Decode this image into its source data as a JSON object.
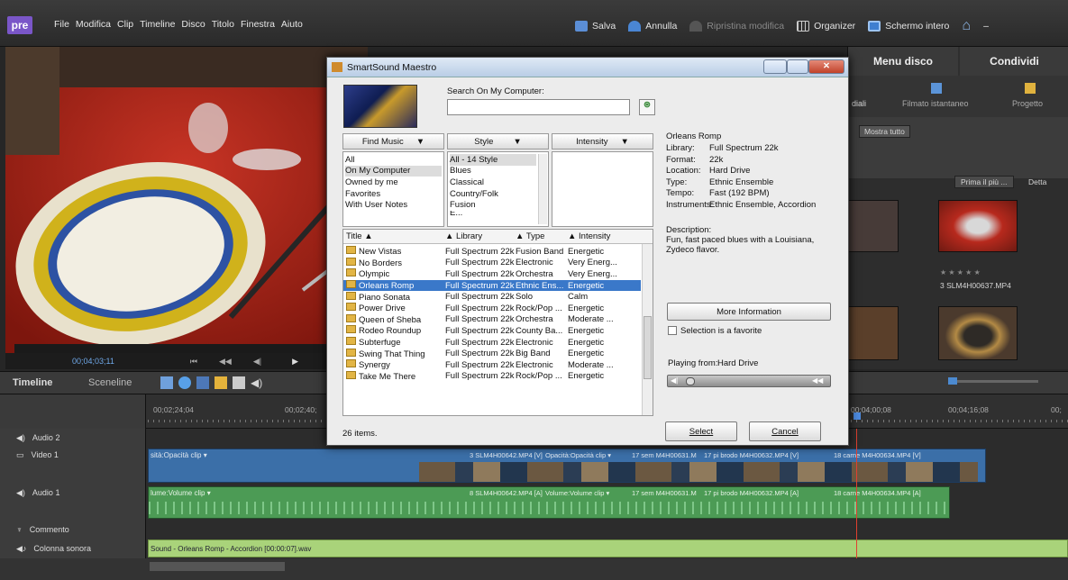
{
  "app": {
    "logo": "pre"
  },
  "menubar": {
    "items": [
      "File",
      "Modifica",
      "Clip",
      "Timeline",
      "Disco",
      "Titolo",
      "Finestra",
      "Aiuto"
    ]
  },
  "toolbar": {
    "save": "Salva",
    "undo": "Annulla",
    "redo": "Ripristina modifica",
    "organizer": "Organizer",
    "fullscreen": "Schermo intero",
    "more": "–"
  },
  "monitor": {
    "timecode": "00;04;03;11"
  },
  "right_panel": {
    "tabs": [
      "Menu disco",
      "Condividi"
    ],
    "sub_left": "diali",
    "sub_center": "Filmato istantaneo",
    "sub_right": "Progetto",
    "show_all": "Mostra tutto",
    "sort_label": "Prima il più ...",
    "detail_label": "Detta",
    "clip_name": "3 SLM4H00637.MP4",
    "clip_stars": "★ ★ ★ ★ ★"
  },
  "timeline": {
    "tabs": [
      "Timeline",
      "Sceneline"
    ],
    "ruler": [
      "00;02;24;04",
      "00;02;40;",
      "00;04;00;08",
      "00;04;16;08",
      "00;"
    ],
    "tracks": [
      {
        "name": "Audio 2"
      },
      {
        "name": "Video 1",
        "clip_label": "sità:Opacità clip ▾",
        "clips": [
          "3 SLM4H00642.MP4 [V]",
          "Opacità:Opacità clip ▾",
          "17 sem M4H00631.M",
          "17 pi brodo M4H00632.MP4 [V]",
          "18 carne M4H00634.MP4 [V]"
        ]
      },
      {
        "name": "Audio 1",
        "clip_label": "lume:Volume clip ▾",
        "clips": [
          "8 SLM4H00642.MP4 [A]",
          "Volume:Volume clip ▾",
          "17 sem M4H00631.M",
          "17 pi brodo M4H00632.MP4 [A]",
          "18 carne M4H00634.MP4 [A]"
        ]
      },
      {
        "name": "Commento"
      },
      {
        "name": "Colonna sonora",
        "clip_label": "Sound - Orleans Romp - Accordion [00:00:07].wav"
      }
    ]
  },
  "dialog": {
    "title": "SmartSound Maestro",
    "search_label": "Search On My Computer:",
    "search_value": "",
    "find_music": "Find Music",
    "style": "Style",
    "intensity": "Intensity",
    "sources": [
      "All",
      "On My Computer",
      "Owned by me",
      "Favorites",
      "With User Notes"
    ],
    "styles": [
      "All - 14 Style",
      "Blues",
      "Classical",
      "Country/Folk",
      "Fusion",
      "E..."
    ],
    "columns": [
      "Title",
      "Library",
      "Type",
      "Intensity"
    ],
    "rows": [
      [
        "New Vistas",
        "Full Spectrum 22k",
        "Fusion Band",
        "Energetic"
      ],
      [
        "No Borders",
        "Full Spectrum 22k",
        "Electronic",
        "Very Energ..."
      ],
      [
        "Olympic",
        "Full Spectrum 22k",
        "Orchestra",
        "Very Energ..."
      ],
      [
        "Orleans Romp",
        "Full Spectrum 22k",
        "Ethnic Ens...",
        "Energetic"
      ],
      [
        "Piano Sonata",
        "Full Spectrum 22k",
        "Solo",
        "Calm"
      ],
      [
        "Power Drive",
        "Full Spectrum 22k",
        "Rock/Pop ...",
        "Energetic"
      ],
      [
        "Queen of Sheba",
        "Full Spectrum 22k",
        "Orchestra",
        "Moderate ..."
      ],
      [
        "Rodeo Roundup",
        "Full Spectrum 22k",
        "County Ba...",
        "Energetic"
      ],
      [
        "Subterfuge",
        "Full Spectrum 22k",
        "Electronic",
        "Energetic"
      ],
      [
        "Swing That Thing",
        "Full Spectrum 22k",
        "Big Band",
        "Energetic"
      ],
      [
        "Synergy",
        "Full Spectrum 22k",
        "Electronic",
        "Moderate ..."
      ],
      [
        "Take Me There",
        "Full Spectrum 22k",
        "Rock/Pop ...",
        "Energetic"
      ]
    ],
    "selected_row": 3,
    "item_count": "26 items.",
    "info": {
      "title": "Orleans Romp",
      "fields": [
        [
          "Library:",
          "Full Spectrum 22k"
        ],
        [
          "Format:",
          "22k"
        ],
        [
          "Location:",
          "Hard Drive"
        ],
        [
          "Type:",
          "Ethnic Ensemble"
        ],
        [
          "Tempo:",
          "Fast (192 BPM)"
        ],
        [
          "Instruments:",
          "Ethnic Ensemble, Accordion"
        ]
      ],
      "description_label": "Description:",
      "description": "Fun, fast paced blues with a Louisiana, Zydeco flavor."
    },
    "more_info": "More Information",
    "favorite_label": "Selection is a favorite",
    "playing_from_label": "Playing from:",
    "playing_from_value": "Hard Drive",
    "select": "Select",
    "cancel": "Cancel"
  },
  "colors": {
    "accent": "#7a56c8",
    "selection": "#3a78c9",
    "soundtrack": "#a9d37a"
  }
}
